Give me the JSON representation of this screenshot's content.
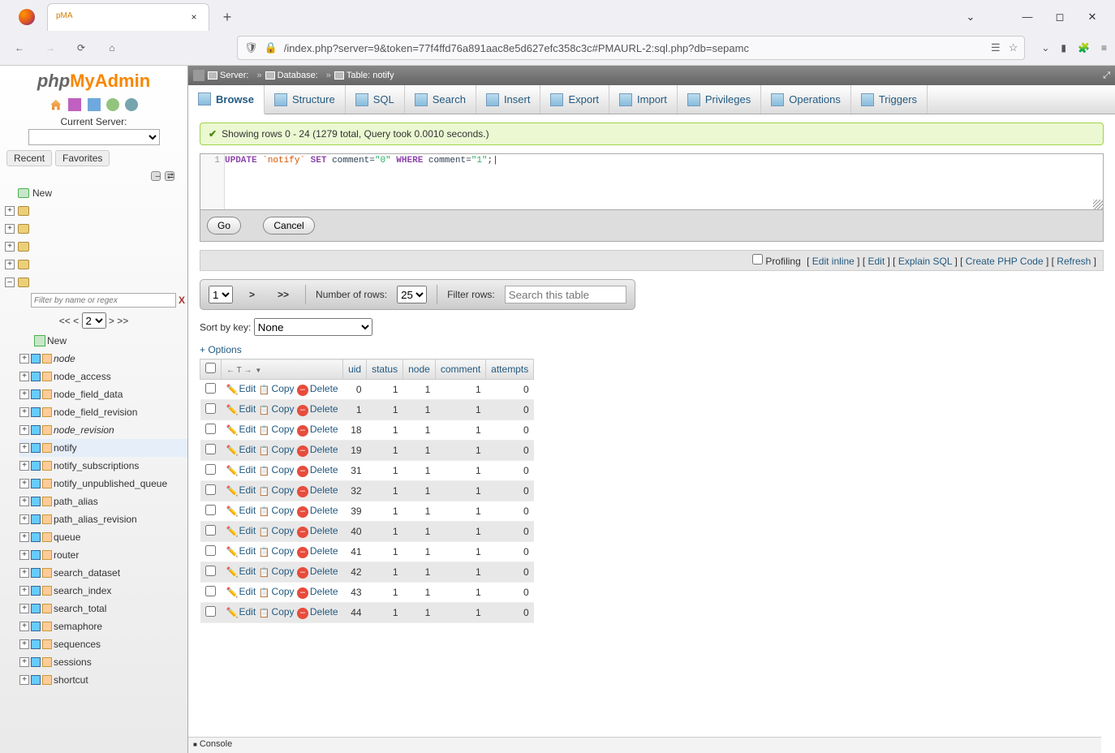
{
  "browser": {
    "tab_title": "",
    "url": "/index.php?server=9&token=77f4ffd76a891aac8e5d627efc358c3c#PMAURL-2:sql.php?db=sepamc"
  },
  "left_nav": {
    "current_server_label": "Current Server:",
    "server_value": "",
    "recent_label": "Recent",
    "favorites_label": "Favorites",
    "new_label": "New",
    "filter_placeholder": "Filter by name or regex",
    "page_nav": {
      "first": "<<",
      "prev": "<",
      "value": "2",
      "next": ">",
      "last": ">>"
    },
    "tables": [
      "node",
      "node_access",
      "node_field_data",
      "node_field_revision",
      "node_revision",
      "notify",
      "notify_subscriptions",
      "notify_unpublished_queue",
      "path_alias",
      "path_alias_revision",
      "queue",
      "router",
      "search_dataset",
      "search_index",
      "search_total",
      "semaphore",
      "sequences",
      "sessions",
      "shortcut"
    ],
    "selected_table": "notify",
    "italic_tables": [
      "node",
      "node_revision"
    ]
  },
  "breadcrumb": {
    "server_label": "Server:",
    "server_value": "",
    "database_label": "Database:",
    "database_value": "",
    "table_label": "Table:",
    "table_value": "notify"
  },
  "tabs": [
    "Browse",
    "Structure",
    "SQL",
    "Search",
    "Insert",
    "Export",
    "Import",
    "Privileges",
    "Operations",
    "Triggers"
  ],
  "active_tab": "Browse",
  "success_msg": "Showing rows 0 - 24 (1279 total, Query took 0.0010 seconds.)",
  "sql": {
    "line_no": "1",
    "tokens": [
      "UPDATE",
      "`notify`",
      "SET",
      "comment=",
      "\"0\"",
      "WHERE",
      "comment=",
      "\"1\"",
      ";"
    ]
  },
  "sql_buttons": {
    "go": "Go",
    "cancel": "Cancel"
  },
  "options_bar": {
    "profiling": "Profiling",
    "links": [
      "Edit inline",
      "Edit",
      "Explain SQL",
      "Create PHP Code",
      "Refresh"
    ]
  },
  "pager": {
    "page_value": "1",
    "next": ">",
    "last": ">>",
    "rows_label": "Number of rows:",
    "rows_value": "25",
    "filter_label": "Filter rows:",
    "filter_placeholder": "Search this table"
  },
  "sort": {
    "label": "Sort by key:",
    "value": "None"
  },
  "options_link": "+ Options",
  "columns": [
    "uid",
    "status",
    "node",
    "comment",
    "attempts"
  ],
  "row_actions": {
    "edit": "Edit",
    "copy": "Copy",
    "delete": "Delete"
  },
  "rows": [
    {
      "uid": 0,
      "status": 1,
      "node": 1,
      "comment": 1,
      "attempts": 0
    },
    {
      "uid": 1,
      "status": 1,
      "node": 1,
      "comment": 1,
      "attempts": 0
    },
    {
      "uid": 18,
      "status": 1,
      "node": 1,
      "comment": 1,
      "attempts": 0
    },
    {
      "uid": 19,
      "status": 1,
      "node": 1,
      "comment": 1,
      "attempts": 0
    },
    {
      "uid": 31,
      "status": 1,
      "node": 1,
      "comment": 1,
      "attempts": 0
    },
    {
      "uid": 32,
      "status": 1,
      "node": 1,
      "comment": 1,
      "attempts": 0
    },
    {
      "uid": 39,
      "status": 1,
      "node": 1,
      "comment": 1,
      "attempts": 0
    },
    {
      "uid": 40,
      "status": 1,
      "node": 1,
      "comment": 1,
      "attempts": 0
    },
    {
      "uid": 41,
      "status": 1,
      "node": 1,
      "comment": 1,
      "attempts": 0
    },
    {
      "uid": 42,
      "status": 1,
      "node": 1,
      "comment": 1,
      "attempts": 0
    },
    {
      "uid": 43,
      "status": 1,
      "node": 1,
      "comment": 1,
      "attempts": 0
    },
    {
      "uid": 44,
      "status": 1,
      "node": 1,
      "comment": 1,
      "attempts": 0
    }
  ],
  "console_label": "Console"
}
